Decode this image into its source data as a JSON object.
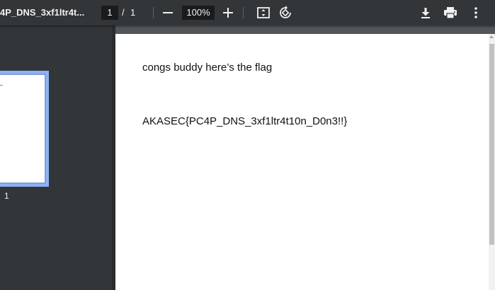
{
  "toolbar": {
    "title": "4P_DNS_3xf1ltr4t...",
    "page_current": "1",
    "page_separator": "/",
    "page_total": "1",
    "zoom": "100%",
    "icons": {
      "zoom_out": "minus-icon",
      "zoom_in": "plus-icon",
      "fit": "fit-page-icon",
      "rotate": "rotate-icon",
      "download": "download-icon",
      "print": "print-icon",
      "more": "more-vert-icon"
    }
  },
  "sidebar": {
    "thumbnails": [
      {
        "label": "1",
        "selected": true
      }
    ]
  },
  "document": {
    "lines": [
      "congs buddy here’s the flag",
      "AKASEC{PC4P_DNS_3xf1ltr4t10n_D0n3!!}"
    ]
  },
  "colors": {
    "toolbar_bg": "#323639",
    "viewer_bg": "#525659",
    "thumb_selected": "#8ab4f8"
  }
}
